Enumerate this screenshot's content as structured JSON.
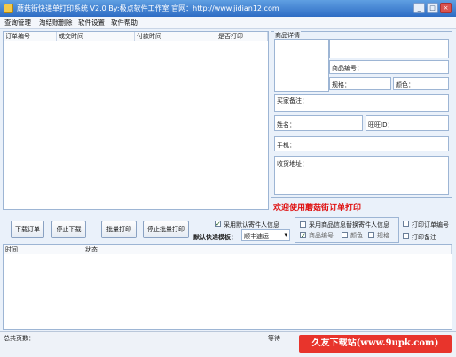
{
  "window": {
    "title": "蘑菇街快递单打印系统 V2.0   By:极点软件工作室   官网：http://www.jidian12.com",
    "minimize_glyph": "_",
    "maximize_glyph": "□",
    "close_glyph": "×"
  },
  "menu": [
    "查询管理",
    "淘结账删除",
    "软件设置",
    "软件帮助"
  ],
  "orders_table": {
    "columns": [
      "订单编号",
      "成交时间",
      "付款时间",
      "是否打印"
    ],
    "rows": []
  },
  "detail": {
    "section_title": "商品详情",
    "product_code_label": "商品编号：",
    "spec_label": "规格：",
    "color_label": "颜色：",
    "buyer_note_label": "买家备注：",
    "name_label": "姓名：",
    "wangwang_label": "旺旺ID：",
    "phone_label": "手机：",
    "address_label": "收货地址："
  },
  "welcome_text": "欢迎使用蘑菇街订单打印",
  "buttons": {
    "download": "下载订单",
    "stop_download": "停止下载",
    "batch_print": "批量打印",
    "stop_batch_print": "停止批量打印"
  },
  "options": {
    "use_default_sender": "采用默认寄件人信息",
    "use_default_sender_checked": true,
    "template_label": "默认快递模板：",
    "template_value": "顺丰速运",
    "use_product_info": "采用商品信息替换寄件人信息",
    "use_product_info_checked": false,
    "product_code_opt": "商品编号",
    "product_code_opt_checked": true,
    "color_opt": "颜色",
    "color_opt_checked": false,
    "spec_opt": "规格",
    "spec_opt_checked": false,
    "print_order_no": "打印订单编号",
    "print_order_no_checked": false,
    "print_remark": "打印备注",
    "print_remark_checked": false
  },
  "log_table": {
    "columns": [
      "时间",
      "状态"
    ],
    "rows": []
  },
  "statusbar": {
    "total_pages": "总共页数：",
    "right_label": "等待"
  },
  "watermark": "久友下载站(www.9upk.com)",
  "colors": {
    "titlebar": "#2e6cc4",
    "welcome_red": "#e01010",
    "watermark_red": "#e8342c"
  }
}
